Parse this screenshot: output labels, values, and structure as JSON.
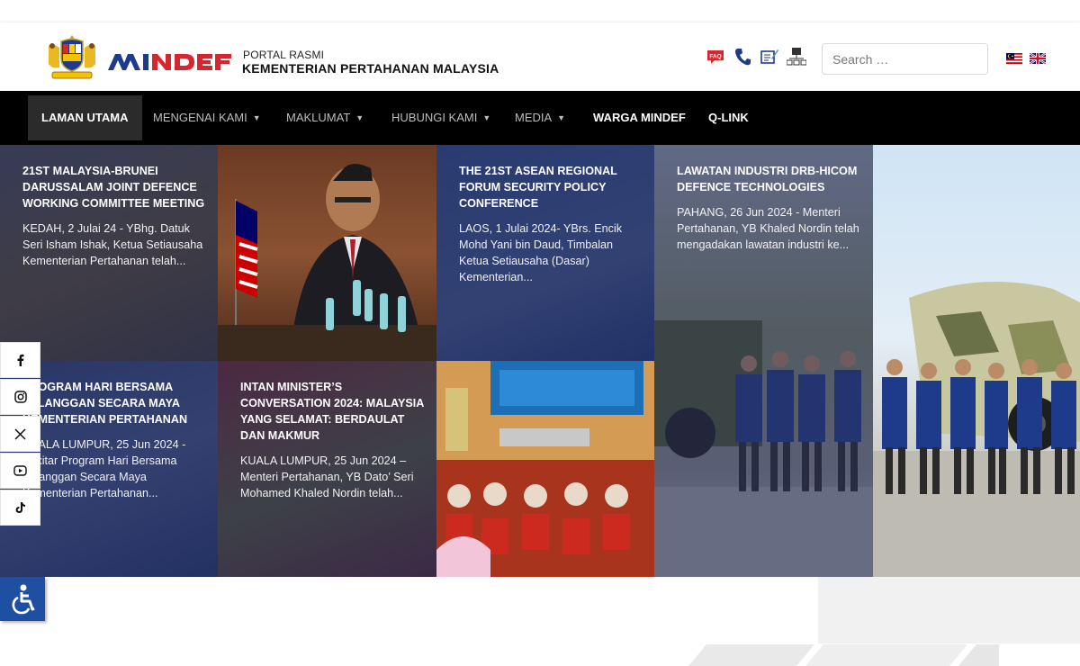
{
  "header": {
    "portal_small": "PORTAL RASMI",
    "portal_big": "KEMENTERIAN PERTAHANAN MALAYSIA",
    "logo_text": "MINDEF",
    "search_placeholder": "Search …",
    "util_icons": [
      "faq-icon",
      "phone-icon",
      "feedback-icon",
      "sitemap-icon"
    ],
    "faq_label": "FAQ",
    "languages": [
      "malay-flag",
      "uk-flag"
    ]
  },
  "nav": {
    "items": [
      {
        "label": "LAMAN UTAMA",
        "active": true,
        "dropdown": false
      },
      {
        "label": "MENGENAI KAMI",
        "active": false,
        "dropdown": true
      },
      {
        "label": "MAKLUMAT",
        "active": false,
        "dropdown": true
      },
      {
        "label": "HUBUNGI KAMI",
        "active": false,
        "dropdown": true
      },
      {
        "label": "MEDIA",
        "active": false,
        "dropdown": true
      },
      {
        "label": "WARGA MINDEF",
        "active": false,
        "dropdown": false
      },
      {
        "label": "Q-LINK",
        "active": false,
        "dropdown": false
      }
    ]
  },
  "news": [
    {
      "title": "21ST MALAYSIA-BRUNEI DARUSSALAM JOINT DEFENCE WORKING COMMITTEE MEETING",
      "excerpt": "KEDAH, 2 Julai 24 - YBhg. Datuk Seri Isham Ishak, Ketua Setiausaha Kementerian Pertahanan telah..."
    },
    {
      "title": "THE 21ST ASEAN REGIONAL FORUM SECURITY POLICY CONFERENCE",
      "excerpt": "LAOS, 1 Julai 2024- YBrs. Encik Mohd Yani bin Daud, Timbalan Ketua Setiausaha (Dasar) Kementerian..."
    },
    {
      "title": "LAWATAN INDUSTRI DRB-HICOM DEFENCE TECHNOLOGIES",
      "excerpt": "PAHANG, 26 Jun 2024 - Menteri Pertahanan, YB Khaled Nordin telah mengadakan lawatan industri ke..."
    },
    {
      "title": "PROGRAM HARI BERSAMA PELANGGAN SECARA MAYA KEMENTERIAN PERTAHANAN",
      "excerpt": "KUALA LUMPUR, 25 Jun 2024 - Sekitar Program Hari Bersama Pelanggan Secara Maya Kementerian Pertahanan..."
    },
    {
      "title": "INTAN MINISTER’S CONVERSATION 2024: MALAYSIA YANG SELAMAT: BERDAULAT DAN MAKMUR",
      "excerpt": "KUALA LUMPUR, 25 Jun 2024 – Menteri Pertahanan, YB Dato’ Seri Mohamed Khaled Nordin telah..."
    }
  ],
  "social": [
    "facebook-icon",
    "instagram-icon",
    "x-icon",
    "youtube-icon",
    "tiktok-icon"
  ],
  "colors": {
    "nav_bg": "#000000",
    "nav_active": "#2b2b2b",
    "tile_overlay": "#1f2a66",
    "logo_blue": "#1e3a8a",
    "logo_red": "#d7262e",
    "accessibility": "#1e4fa1"
  }
}
